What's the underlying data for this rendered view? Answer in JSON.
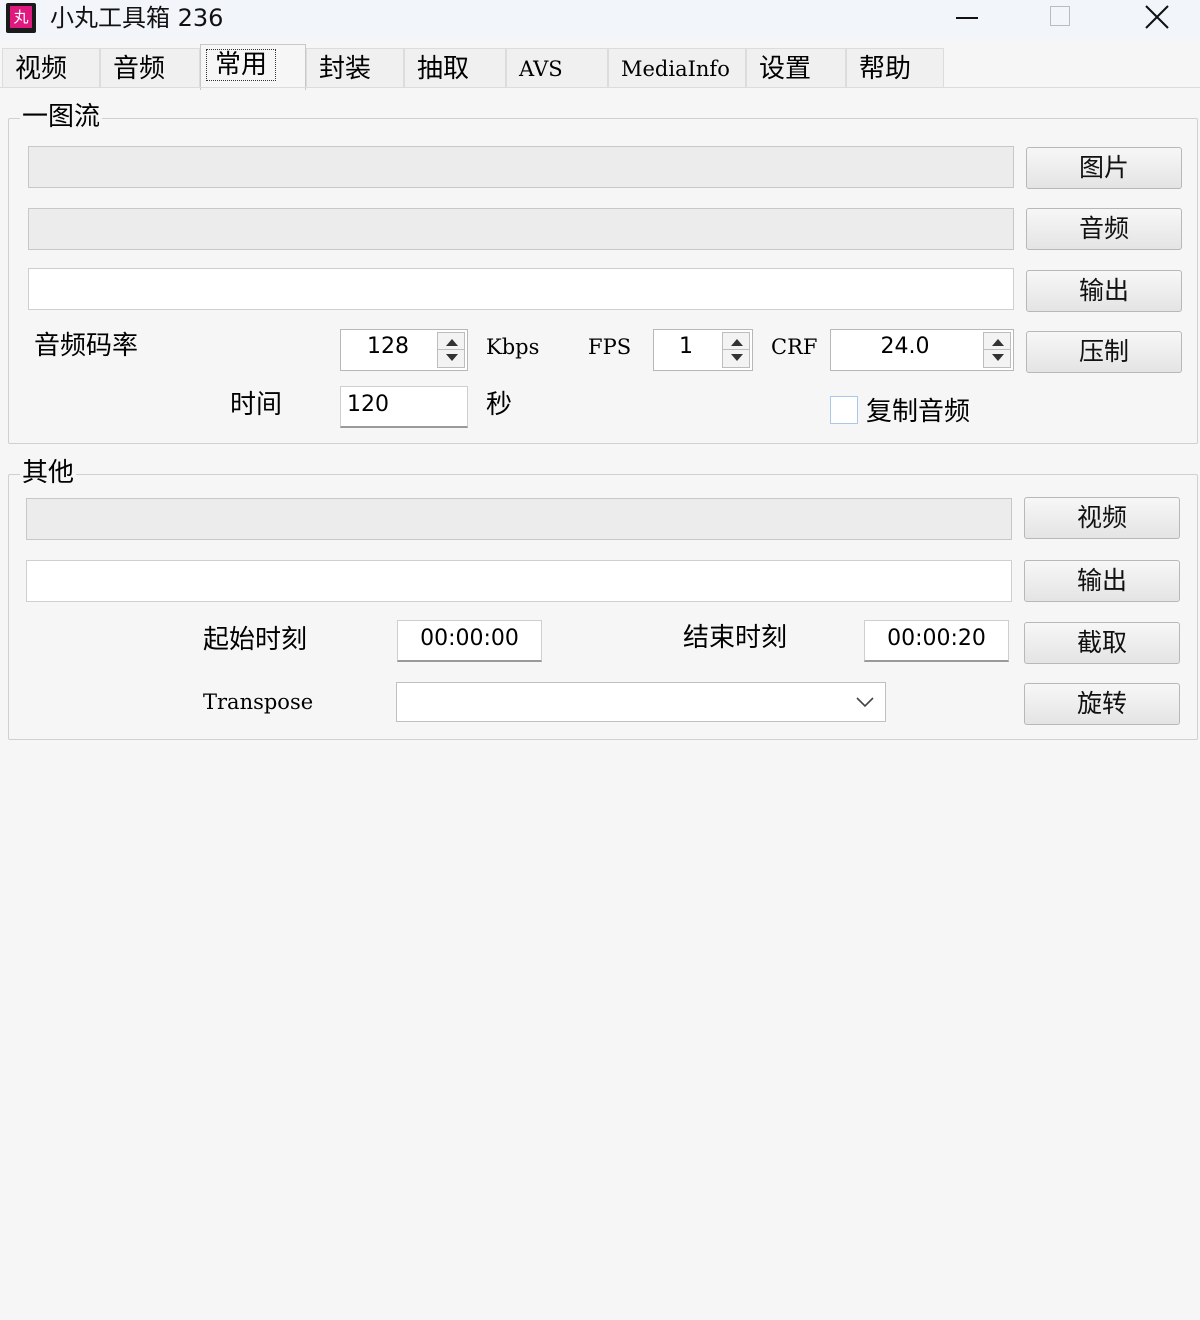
{
  "window": {
    "title": "小丸工具箱 236",
    "icon_glyph": "丸",
    "controls": {
      "minimize": "minimize-icon",
      "maximize": "maximize-icon",
      "close": "close-icon"
    }
  },
  "tabs": [
    {
      "label": "视频"
    },
    {
      "label": "音频"
    },
    {
      "label": "常用",
      "active": true
    },
    {
      "label": "封装"
    },
    {
      "label": "抽取"
    },
    {
      "label": "AVS"
    },
    {
      "label": "MediaInfo"
    },
    {
      "label": "设置"
    },
    {
      "label": "帮助"
    }
  ],
  "group1": {
    "title": "一图流",
    "image_field": "",
    "audio_field": "",
    "output_field": "",
    "btn_image": "图片",
    "btn_audio": "音频",
    "btn_output": "输出",
    "btn_encode": "压制",
    "bitrate_label": "音频码率",
    "bitrate_value": "128",
    "bitrate_unit": "Kbps",
    "fps_label": "FPS",
    "fps_value": "1",
    "crf_label": "CRF",
    "crf_value": "24.0",
    "time_label": "时间",
    "time_value": "120",
    "time_unit": "秒",
    "copy_audio_label": "复制音频",
    "copy_audio_checked": false
  },
  "group2": {
    "title": "其他",
    "video_field": "",
    "output_field": "",
    "btn_video": "视频",
    "btn_output": "输出",
    "btn_cut": "截取",
    "btn_rotate": "旋转",
    "start_label": "起始时刻",
    "start_value": "00:00:00",
    "end_label": "结束时刻",
    "end_value": "00:00:20",
    "transpose_label": "Transpose",
    "transpose_value": ""
  },
  "colors": {
    "accent": "#e0197f",
    "background": "#f6f6f6",
    "titlebar": "#f2f5fa"
  }
}
